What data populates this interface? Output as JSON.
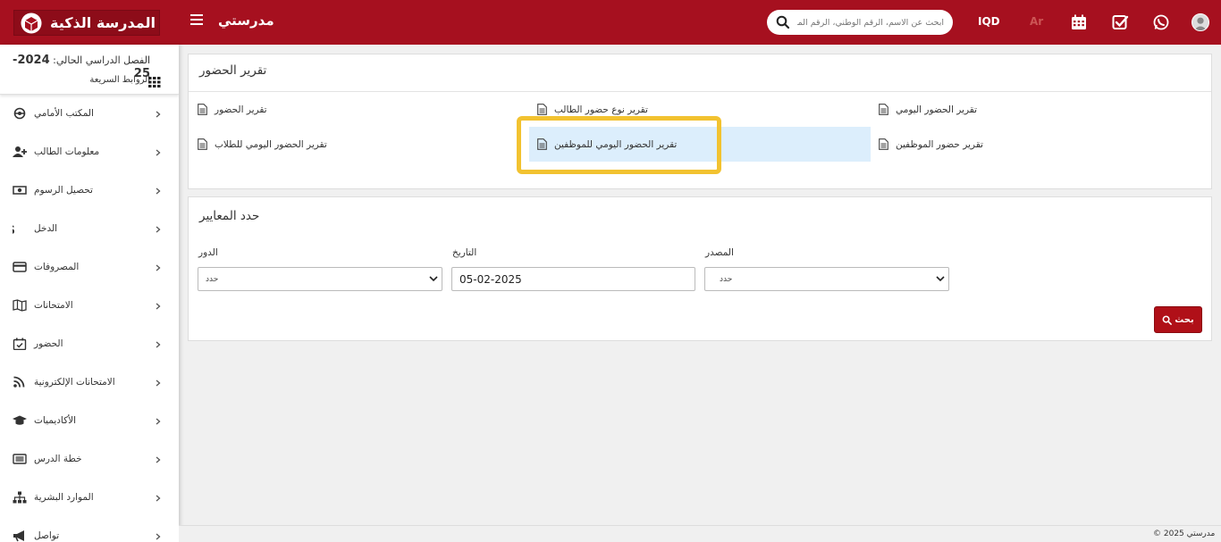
{
  "header": {
    "logo_text": "المدرسة الذكية",
    "app_name": "مدرستي",
    "search_placeholder": "ابحث عن الاسم، الرقم الوطني، الرقم المحلي، إلخ",
    "currency": "IQD",
    "language": "Ar",
    "colors": {
      "brand": "#a6101f",
      "accent": "#f2c230",
      "active_bg": "#dceefc"
    },
    "icons": [
      "calendar-icon",
      "check-square-icon",
      "whatsapp-icon",
      "user-avatar-icon"
    ]
  },
  "sidebar": {
    "semester_label": "الفصل الدراسي الحالي:",
    "semester_value": "2024-25",
    "quick_links": "الروابط السريعة",
    "items": [
      {
        "label": "المكتب الأمامي",
        "icon": "front-desk-icon"
      },
      {
        "label": "معلومات الطالب",
        "icon": "user-plus-icon"
      },
      {
        "label": "تحصيل الرسوم",
        "icon": "money-icon"
      },
      {
        "label": "الدخل",
        "icon": "dollar-icon"
      },
      {
        "label": "المصروفات",
        "icon": "credit-card-icon"
      },
      {
        "label": "الامتحانات",
        "icon": "map-icon"
      },
      {
        "label": "الحضور",
        "icon": "calendar-check-icon"
      },
      {
        "label": "الامتحانات الإلكترونية",
        "icon": "rss-icon"
      },
      {
        "label": "الأكاديميات",
        "icon": "graduation-cap-icon"
      },
      {
        "label": "خطة الدرس",
        "icon": "list-icon"
      },
      {
        "label": "الموارد البشرية",
        "icon": "sitemap-icon"
      },
      {
        "label": "تواصل",
        "icon": "megaphone-icon"
      }
    ]
  },
  "reports": {
    "title": "تقرير الحضور",
    "links": [
      {
        "label": "تقرير الحضور اليومي"
      },
      {
        "label": "تقرير نوع حضور الطالب"
      },
      {
        "label": "تقرير الحضور"
      },
      {
        "label": "تقرير حضور الموظفين"
      },
      {
        "label": "تقرير الحضور اليومي للموظفين"
      },
      {
        "label": "تقرير الحضور اليومي للطلاب"
      }
    ]
  },
  "criteria": {
    "title": "حدد المعايير",
    "role_label": "الدور",
    "role_value": "حدد",
    "date_label": "التاريخ",
    "date_value": "05-02-2025",
    "source_label": "المصدر",
    "source_value": "حدد",
    "search_button": "بحث"
  },
  "footer": {
    "copyright": "مدرستي 2025 ©"
  }
}
